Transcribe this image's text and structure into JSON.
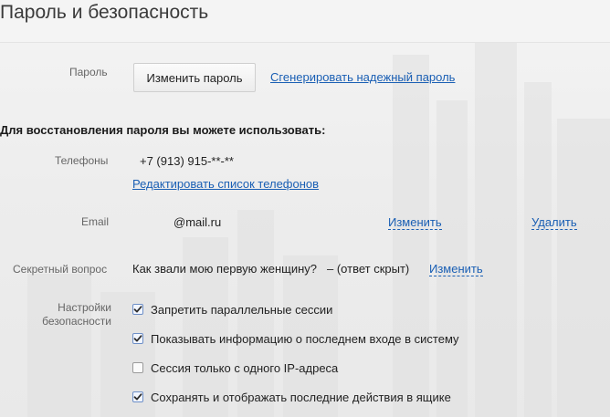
{
  "page": {
    "title": "Пароль и безопасность"
  },
  "password": {
    "label": "Пароль",
    "change_button": "Изменить пароль",
    "generate_link": "Сгенерировать надежный пароль"
  },
  "recovery": {
    "heading": "Для восстановления пароля вы можете использовать:",
    "phones": {
      "label": "Телефоны",
      "value": "+7 (913) 915-**-**",
      "edit_link": "Редактировать список телефонов"
    },
    "email": {
      "label": "Email",
      "value": "@mail.ru",
      "change_link": "Изменить",
      "delete_link": "Удалить"
    },
    "secret_question": {
      "label": "Секретный вопрос",
      "question": "Как звали мою первую женщину?",
      "answer_state": "– (ответ скрыт)",
      "change_link": "Изменить"
    }
  },
  "security": {
    "label_line1": "Настройки",
    "label_line2": "безопасности",
    "options": [
      {
        "label": "Запретить параллельные сессии",
        "checked": true
      },
      {
        "label": "Показывать информацию о последнем входе в систему",
        "checked": true
      },
      {
        "label": "Сессия только с одного IP-адреса",
        "checked": false
      },
      {
        "label": "Сохранять и отображать последние действия в ящике",
        "checked": true
      }
    ]
  },
  "colors": {
    "link": "#1a5fb4",
    "checkbox_border_checked": "#6d8fc7"
  },
  "icons": {
    "check": "checkmark-icon"
  }
}
